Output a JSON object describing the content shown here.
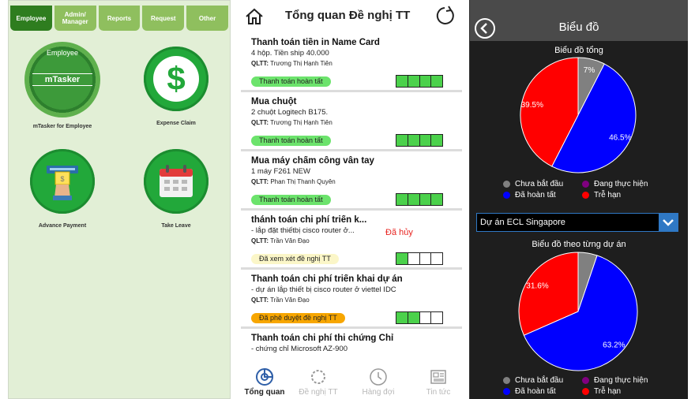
{
  "panel1": {
    "tabs": [
      "Employee",
      "Admin/ Manager",
      "Reports",
      "Request",
      "Other"
    ],
    "active_tab": 0,
    "seal_top_text": "Employee",
    "seal_text": "mTasker",
    "apps": [
      {
        "label": "mTasker for Employee",
        "icon": "mtasker-seal-icon"
      },
      {
        "label": "Expense Claim",
        "icon": "dollar-icon"
      },
      {
        "label": "Advance Payment",
        "icon": "atm-icon"
      },
      {
        "label": "Take Leave",
        "icon": "calendar-icon"
      }
    ]
  },
  "panel2": {
    "title": "Tổng quan Đề nghị TT",
    "qltt_prefix": "QLTT:",
    "cards": [
      {
        "title": "Thanh toán tiền in Name Card",
        "desc": "4 hộp. Tiền ship 40.000",
        "qltt": "Trương Thị Hạnh Tiên",
        "status": "Thanh toán hoàn tất",
        "status_color": "#6ce36c",
        "steps_done": 4,
        "cancelled": ""
      },
      {
        "title": "Mua chuột",
        "desc": "2 chuột Logitech B175.",
        "qltt": "Trương Thị Hạnh Tiên",
        "status": "Thanh toán hoàn tất",
        "status_color": "#6ce36c",
        "steps_done": 4,
        "cancelled": ""
      },
      {
        "title": "Mua máy chấm công vân tay",
        "desc": "1 máy F261 NEW",
        "qltt": "Phan Thị Thanh Quyên",
        "status": "Thanh toán hoàn tất",
        "status_color": "#6ce36c",
        "steps_done": 4,
        "cancelled": ""
      },
      {
        "title": "thánh toán chi phí triển k...",
        "desc": "- lắp đặt thiếtbị cisco router ở...",
        "qltt": "Trần Văn Đạo",
        "status": "Đã xem xét đề nghị TT",
        "status_color": "#fbf6c8",
        "steps_done": 1,
        "cancelled": "Đã hủy"
      },
      {
        "title": "Thanh toán chi phí triển khai dự án",
        "desc": "- dự án lắp thiết bị cisco router ở viettel IDC",
        "qltt": "Trần Văn Đạo",
        "status": "Đã phê duyệt đề nghị TT",
        "status_color": "#f7a600",
        "steps_done": 2,
        "cancelled": ""
      },
      {
        "title": "Thanh toán chi phí thi chứng Chỉ",
        "desc": "- chứng chỉ Microsoft AZ-900",
        "qltt": "",
        "status": "",
        "status_color": "",
        "steps_done": 0,
        "cancelled": ""
      }
    ],
    "nav": [
      {
        "label": "Tổng quan",
        "icon": "overview-icon",
        "active": true
      },
      {
        "label": "Đề nghị TT",
        "icon": "request-icon",
        "active": false
      },
      {
        "label": "Hàng đợi",
        "icon": "clock-icon",
        "active": false
      },
      {
        "label": "Tin tức",
        "icon": "news-icon",
        "active": false
      }
    ]
  },
  "panel3": {
    "title": "Biểu đồ",
    "dropdown_value": "Dự án ECL Singapore",
    "legend": [
      {
        "label": "Chưa bắt đầu",
        "color": "#808080"
      },
      {
        "label": "Đang thực hiện",
        "color": "#800080"
      },
      {
        "label": "Đã hoàn tất",
        "color": "#0000ff"
      },
      {
        "label": "Trễ hạn",
        "color": "#ff0000"
      }
    ]
  },
  "chart_data": [
    {
      "type": "pie",
      "title": "Biểu đồ tổng",
      "categories": [
        "Chưa bắt đầu",
        "Đang thực hiện",
        "Đã hoàn tất",
        "Trễ hạn"
      ],
      "values": [
        7,
        0,
        46.5,
        39.5
      ],
      "labels": [
        "7%",
        "",
        "46.5%",
        "39.5%"
      ],
      "colors": [
        "#808080",
        "#800080",
        "#0000ff",
        "#ff0000"
      ]
    },
    {
      "type": "pie",
      "title": "Biểu đồ theo từng dự án",
      "categories": [
        "Chưa bắt đầu",
        "Đang thực hiện",
        "Đã hoàn tất",
        "Trễ hạn"
      ],
      "values": [
        5.2,
        0,
        63.2,
        31.6
      ],
      "labels": [
        "",
        "",
        "63.2%",
        "31.6%"
      ],
      "colors": [
        "#808080",
        "#800080",
        "#0000ff",
        "#ff0000"
      ]
    }
  ]
}
